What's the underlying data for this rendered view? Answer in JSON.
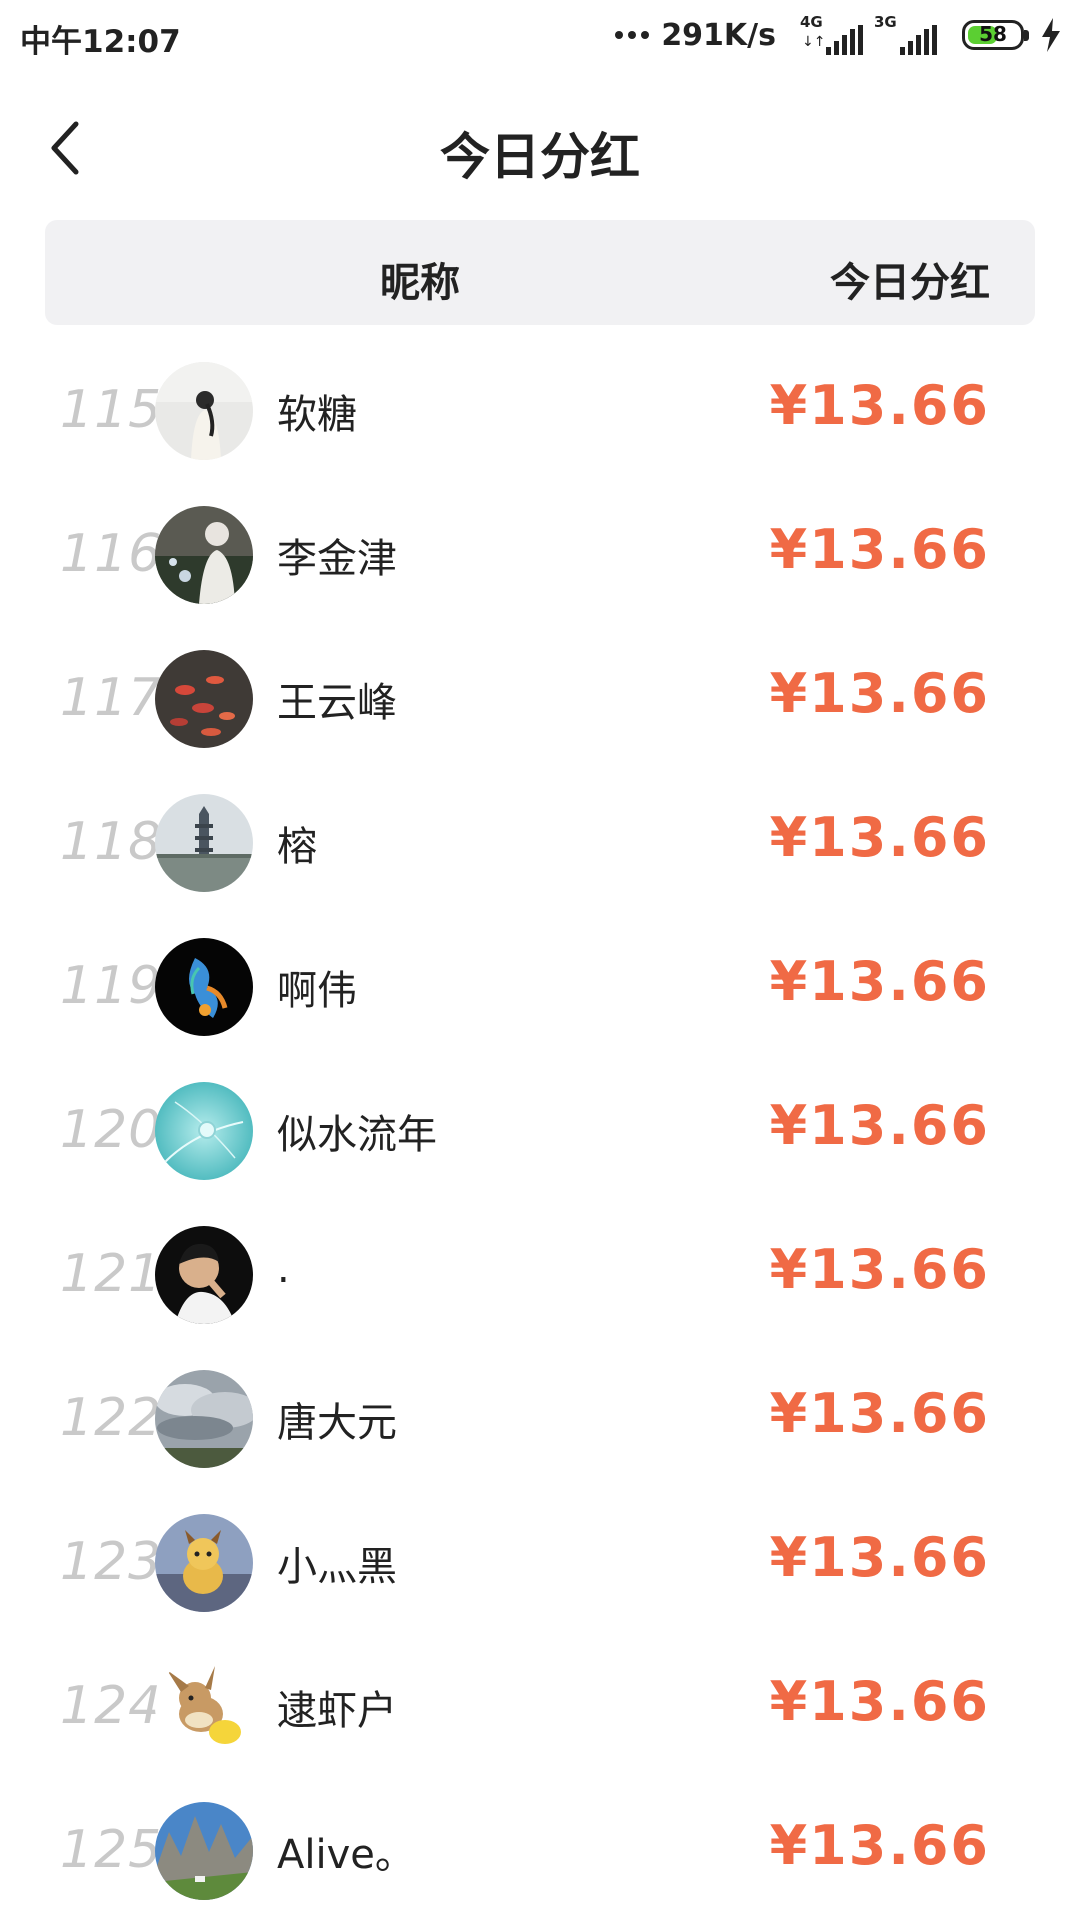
{
  "status_bar": {
    "time": "中午12:07",
    "net_speed": "291K/s",
    "signal_1_tag": "4G",
    "signal_2_tag": "3G",
    "battery": "58",
    "battery_level": 0.58,
    "battery_color": "#5bcf32"
  },
  "nav": {
    "title": "今日分红"
  },
  "table": {
    "header_nickname": "昵称",
    "header_dividend": "今日分红"
  },
  "accent_color": "#f06a45",
  "rows": [
    {
      "rank": "115",
      "nickname": "软糖",
      "amount": "¥13.66"
    },
    {
      "rank": "116",
      "nickname": "李金津",
      "amount": "¥13.66"
    },
    {
      "rank": "117",
      "nickname": "王云峰",
      "amount": "¥13.66"
    },
    {
      "rank": "118",
      "nickname": "榕",
      "amount": "¥13.66"
    },
    {
      "rank": "119",
      "nickname": "啊伟",
      "amount": "¥13.66"
    },
    {
      "rank": "120",
      "nickname": "似水流年",
      "amount": "¥13.66"
    },
    {
      "rank": "121",
      "nickname": ".",
      "amount": "¥13.66"
    },
    {
      "rank": "122",
      "nickname": "唐大元",
      "amount": "¥13.66"
    },
    {
      "rank": "123",
      "nickname": "小灬黑",
      "amount": "¥13.66"
    },
    {
      "rank": "124",
      "nickname": "逮虾户",
      "amount": "¥13.66"
    },
    {
      "rank": "125",
      "nickname": "Alive。",
      "amount": "¥13.66"
    }
  ]
}
